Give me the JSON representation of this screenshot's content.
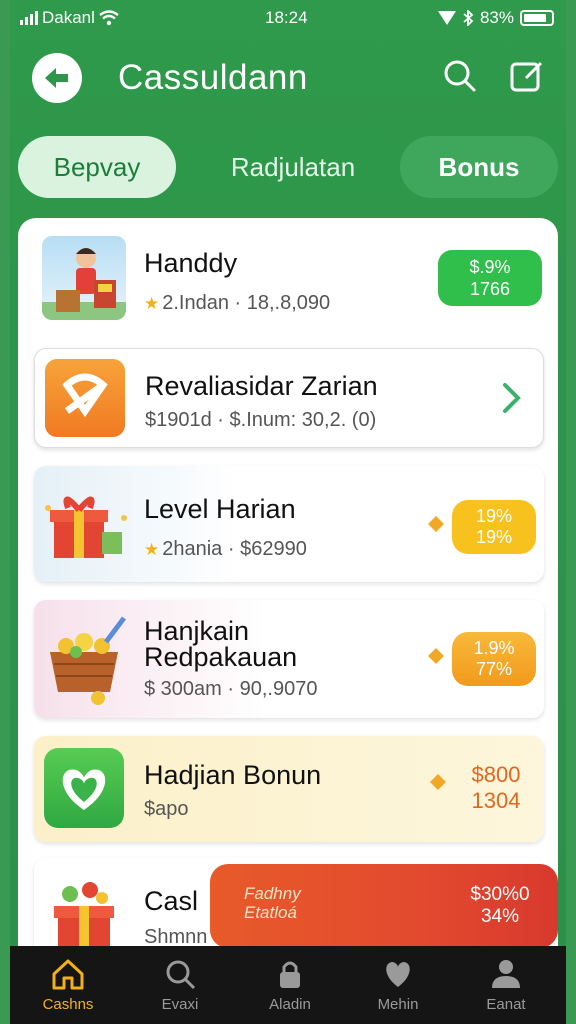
{
  "status_bar": {
    "carrier": "Dakanl",
    "time": "18:24",
    "battery": "83%"
  },
  "header": {
    "title": "Cassuldann",
    "back_icon": "arrow-left-icon",
    "search_icon": "search-icon",
    "edit_icon": "edit-icon"
  },
  "tabs": [
    {
      "label": "Bepvay",
      "active": true
    },
    {
      "label": "Radjulatan",
      "active": false
    },
    {
      "label": "Bonus",
      "active": false
    }
  ],
  "items": [
    {
      "title": "Handdy",
      "subtitle": "2.Indan · 18,.8,090",
      "badge": [
        "$.9%",
        "1766"
      ],
      "icon": "person-with-boxes-image"
    },
    {
      "title": "Revaliasidar Zarian",
      "subtitle": "$1901d · $.Inum: 30,2. (0)",
      "icon": "app-tile-icon"
    },
    {
      "title": "Level Harian",
      "subtitle": "2hania · $62990",
      "badge": [
        "19%",
        "19%"
      ],
      "icon": "gift-box-image"
    },
    {
      "title": "Hanjkain\nRedpakauan",
      "subtitle": "$ 300am · 90,.9070",
      "badge": [
        "1.9%",
        "77%"
      ],
      "icon": "coin-basket-image"
    },
    {
      "title": "Hadjian Bonun",
      "subtitle": "$apo",
      "badge": [
        "$800",
        "1304"
      ],
      "icon": "heart-app-icon"
    },
    {
      "title": "Casl",
      "subtitle": "Shmnn",
      "promo": [
        "Fadhny",
        "Etatloá"
      ],
      "badge": [
        "$30%0",
        "34%"
      ],
      "icon": "gift-box-image"
    }
  ],
  "nav": [
    {
      "label": "Cashns",
      "icon": "home-icon",
      "active": true
    },
    {
      "label": "Evaxi",
      "icon": "search-icon",
      "active": false
    },
    {
      "label": "Aladin",
      "icon": "lock-icon",
      "active": false
    },
    {
      "label": "Mehin",
      "icon": "heart-icon",
      "active": false
    },
    {
      "label": "Eanat",
      "icon": "profile-icon",
      "active": false
    }
  ],
  "colors": {
    "primary": "#2e964a",
    "accent_green": "#2fbf4a",
    "accent_yellow": "#f7c21d",
    "nav_bg": "#151515"
  }
}
